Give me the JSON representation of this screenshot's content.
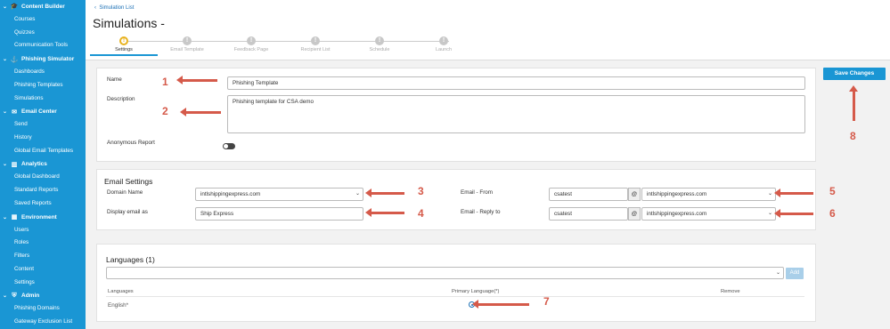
{
  "sidebar": {
    "sections": [
      {
        "label": "Content Builder",
        "icon": "graduation-cap-icon",
        "items": [
          "Courses",
          "Quizzes",
          "Communication Tools"
        ]
      },
      {
        "label": "Phishing Simulator",
        "icon": "hook-icon",
        "items": [
          "Dashboards",
          "Phishing Templates",
          "Simulations"
        ]
      },
      {
        "label": "Email Center",
        "icon": "envelope-icon",
        "items": [
          "Send",
          "History",
          "Global Email Templates"
        ]
      },
      {
        "label": "Analytics",
        "icon": "bar-chart-icon",
        "items": [
          "Global Dashboard",
          "Standard Reports",
          "Saved Reports"
        ]
      },
      {
        "label": "Environment",
        "icon": "grid-icon",
        "items": [
          "Users",
          "Roles",
          "Filters",
          "Content",
          "Settings"
        ]
      },
      {
        "label": "Admin",
        "icon": "shield-icon",
        "items": [
          "Phishing Domains",
          "Gateway Exclusion List"
        ]
      }
    ]
  },
  "header": {
    "breadcrumb": "Simulation List",
    "title": "Simulations -",
    "steps": [
      "Settings",
      "Email Template",
      "Feedback Page",
      "Recipient List",
      "Schedule",
      "Launch"
    ],
    "active_step": "Settings"
  },
  "general": {
    "name_label": "Name",
    "name_value": "Phishing Template",
    "description_label": "Description",
    "description_value": "Phishing template for CSA demo",
    "anonymous_label": "Anonymous Report",
    "anonymous_on": false
  },
  "email_settings": {
    "title": "Email Settings",
    "domain_label": "Domain Name",
    "domain_value": "intlshippingexpress.com",
    "display_label": "Display email as",
    "display_value": "Ship Express",
    "from_label": "Email - From",
    "from_user": "csatest",
    "from_domain": "intlshippingexpress.com",
    "reply_label": "Email - Reply to",
    "reply_user": "csatest",
    "reply_domain": "intlshippingexpress.com",
    "at": "@"
  },
  "languages": {
    "title": "Languages (1)",
    "add_label": "Add",
    "headers": [
      "Languages",
      "Primary Language(*)",
      "Remove"
    ],
    "rows": [
      {
        "language": "English*",
        "primary": true
      }
    ]
  },
  "save_label": "Save Changes",
  "annotations": [
    "1",
    "2",
    "3",
    "4",
    "5",
    "6",
    "7",
    "8"
  ],
  "colors": {
    "sidebar": "#1a96d4",
    "annotation": "#d55a4a",
    "active_step": "#e8b21f"
  }
}
